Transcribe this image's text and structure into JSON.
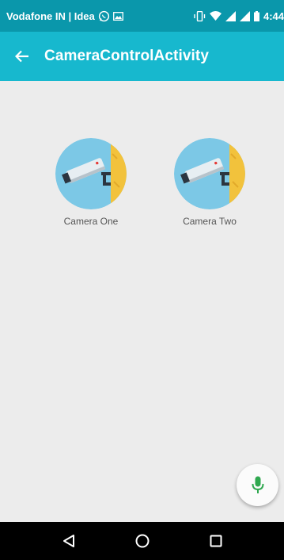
{
  "status_bar": {
    "carrier": "Vodafone IN | Idea",
    "time": "4:44",
    "icons": [
      "whatsapp-icon",
      "image-icon",
      "vibrate-icon",
      "wifi-icon",
      "signal-icon",
      "signal-icon",
      "battery-icon"
    ]
  },
  "app_bar": {
    "title": "CameraControlActivity",
    "back_icon": "arrow-left-icon"
  },
  "cameras": [
    {
      "label": "Camera One",
      "icon": "security-camera-icon"
    },
    {
      "label": "Camera Two",
      "icon": "security-camera-icon"
    }
  ],
  "fab": {
    "icon": "microphone-icon",
    "color": "#2fa84f"
  },
  "nav_bar": {
    "buttons": [
      "back-triangle-icon",
      "home-circle-icon",
      "recents-square-icon"
    ]
  },
  "colors": {
    "status_bar": "#0a97ab",
    "app_bar": "#17b8ce",
    "background": "#ececec",
    "camera_circle": "#7cc8e6",
    "wall": "#f2c23c"
  }
}
